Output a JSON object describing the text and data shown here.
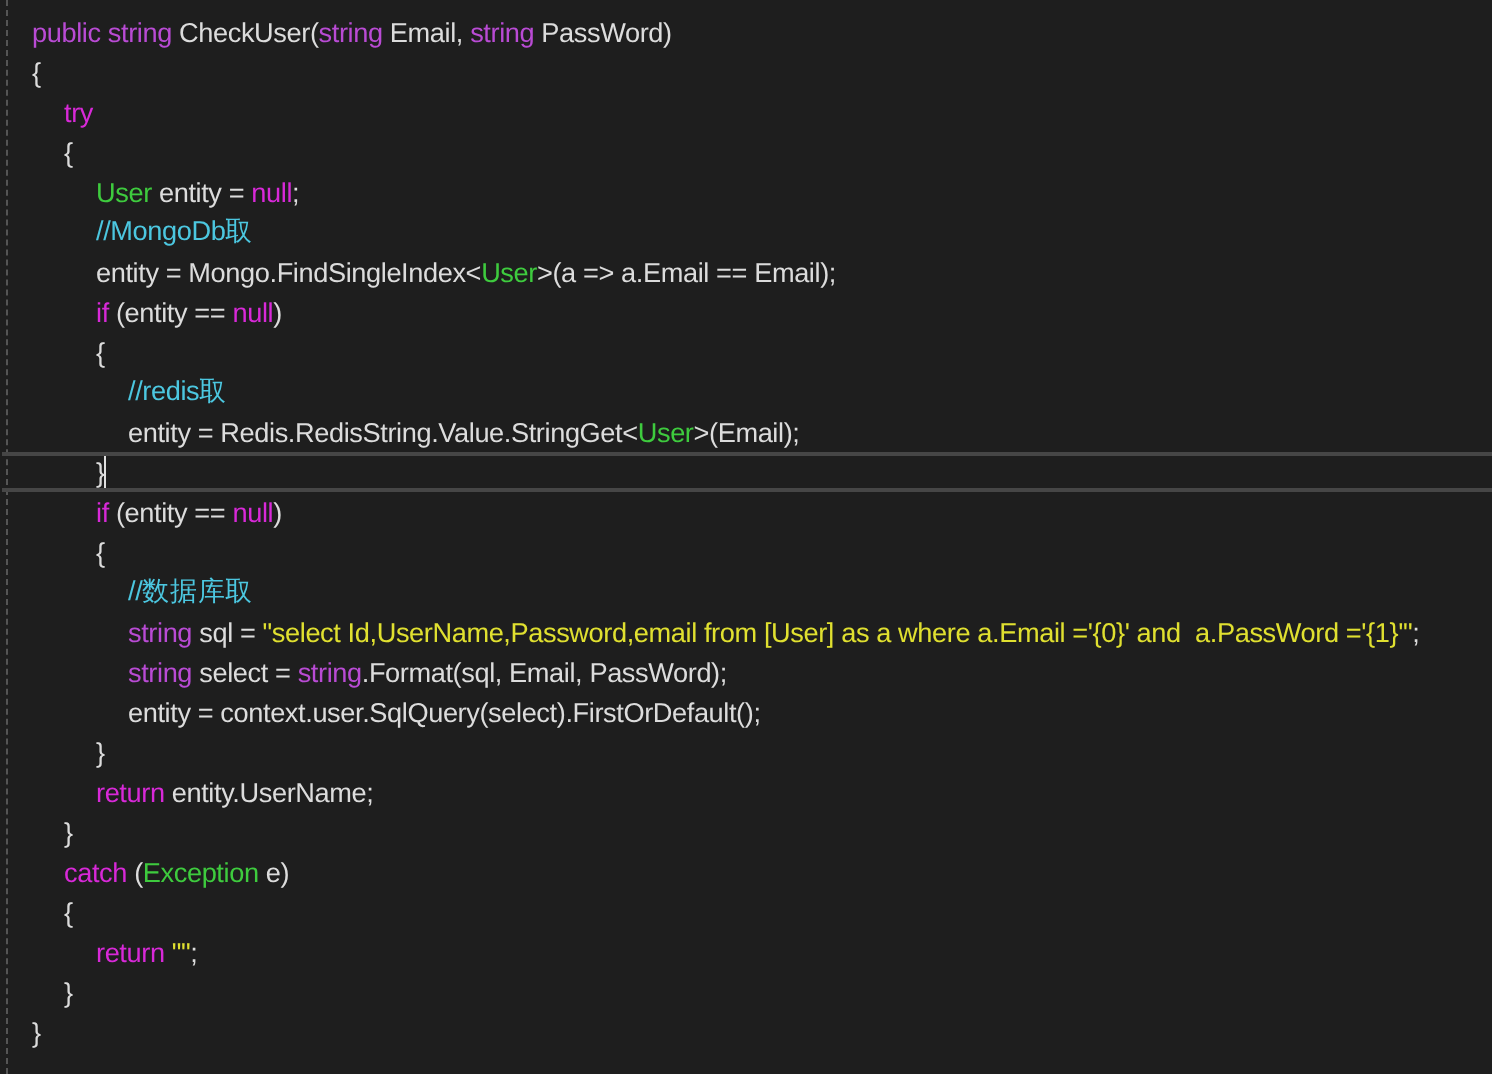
{
  "editor": {
    "lines": [
      {
        "current": false,
        "tokens": [
          {
            "kind": "keyword",
            "text": "public string"
          },
          {
            "kind": "plain",
            "text": " CheckUser("
          },
          {
            "kind": "keyword",
            "text": "string"
          },
          {
            "kind": "plain",
            "text": " Email, "
          },
          {
            "kind": "keyword",
            "text": "string"
          },
          {
            "kind": "plain",
            "text": " PassWord)"
          }
        ]
      },
      {
        "current": false,
        "tokens": [
          {
            "kind": "plain",
            "text": "{"
          }
        ],
        "children": [
          {
            "current": false,
            "tokens": [
              {
                "kind": "control",
                "text": "try"
              }
            ]
          },
          {
            "current": false,
            "tokens": [
              {
                "kind": "plain",
                "text": "{"
              }
            ],
            "children": [
              {
                "current": false,
                "tokens": [
                  {
                    "kind": "type",
                    "text": "User"
                  },
                  {
                    "kind": "plain",
                    "text": " entity = "
                  },
                  {
                    "kind": "control",
                    "text": "null"
                  },
                  {
                    "kind": "plain",
                    "text": ";"
                  }
                ]
              },
              {
                "current": false,
                "tokens": [
                  {
                    "kind": "comment",
                    "text": "//MongoDb取"
                  }
                ]
              },
              {
                "current": false,
                "tokens": [
                  {
                    "kind": "plain",
                    "text": "entity = Mongo.FindSingleIndex<"
                  },
                  {
                    "kind": "type",
                    "text": "User"
                  },
                  {
                    "kind": "plain",
                    "text": ">(a => a.Email == Email);"
                  }
                ]
              },
              {
                "current": false,
                "tokens": [
                  {
                    "kind": "control",
                    "text": "if"
                  },
                  {
                    "kind": "plain",
                    "text": " (entity == "
                  },
                  {
                    "kind": "control",
                    "text": "null"
                  },
                  {
                    "kind": "plain",
                    "text": ")"
                  }
                ]
              },
              {
                "current": false,
                "tokens": [
                  {
                    "kind": "plain",
                    "text": "{"
                  }
                ],
                "children": [
                  {
                    "current": false,
                    "tokens": [
                      {
                        "kind": "comment",
                        "text": "//redis取"
                      }
                    ]
                  },
                  {
                    "current": false,
                    "tokens": [
                      {
                        "kind": "plain",
                        "text": "entity = Redis.RedisString.Value.StringGet<"
                      },
                      {
                        "kind": "type",
                        "text": "User"
                      },
                      {
                        "kind": "plain",
                        "text": ">(Email);"
                      }
                    ]
                  }
                ]
              },
              {
                "current": true,
                "tokens": [
                  {
                    "kind": "plain",
                    "text": "}"
                  }
                ]
              },
              {
                "current": false,
                "tokens": [
                  {
                    "kind": "control",
                    "text": "if"
                  },
                  {
                    "kind": "plain",
                    "text": " (entity == "
                  },
                  {
                    "kind": "control",
                    "text": "null"
                  },
                  {
                    "kind": "plain",
                    "text": ")"
                  }
                ]
              },
              {
                "current": false,
                "tokens": [
                  {
                    "kind": "plain",
                    "text": "{"
                  }
                ],
                "children": [
                  {
                    "current": false,
                    "tokens": [
                      {
                        "kind": "comment",
                        "text": "//数据库取"
                      }
                    ]
                  },
                  {
                    "current": false,
                    "tokens": [
                      {
                        "kind": "keyword",
                        "text": "string"
                      },
                      {
                        "kind": "plain",
                        "text": " sql = "
                      },
                      {
                        "kind": "string",
                        "text": "\"select Id,UserName,Password,email from [User] as a where a.Email ='{0}' and  a.PassWord ='{1}'\""
                      },
                      {
                        "kind": "plain",
                        "text": ";"
                      }
                    ]
                  },
                  {
                    "current": false,
                    "tokens": [
                      {
                        "kind": "keyword",
                        "text": "string"
                      },
                      {
                        "kind": "plain",
                        "text": " select = "
                      },
                      {
                        "kind": "keyword",
                        "text": "string"
                      },
                      {
                        "kind": "plain",
                        "text": ".Format(sql, Email, PassWord);"
                      }
                    ]
                  },
                  {
                    "current": false,
                    "tokens": [
                      {
                        "kind": "plain",
                        "text": "entity = context.user.SqlQuery(select).FirstOrDefault();"
                      }
                    ]
                  }
                ]
              },
              {
                "current": false,
                "tokens": [
                  {
                    "kind": "plain",
                    "text": "}"
                  }
                ]
              },
              {
                "current": false,
                "tokens": [
                  {
                    "kind": "control",
                    "text": "return"
                  },
                  {
                    "kind": "plain",
                    "text": " entity.UserName;"
                  }
                ]
              }
            ]
          },
          {
            "current": false,
            "tokens": [
              {
                "kind": "plain",
                "text": "}"
              }
            ]
          },
          {
            "current": false,
            "tokens": [
              {
                "kind": "control",
                "text": "catch"
              },
              {
                "kind": "plain",
                "text": " ("
              },
              {
                "kind": "type",
                "text": "Exception"
              },
              {
                "kind": "plain",
                "text": " e)"
              }
            ]
          },
          {
            "current": false,
            "tokens": [
              {
                "kind": "plain",
                "text": "{"
              }
            ],
            "children": [
              {
                "current": false,
                "tokens": [
                  {
                    "kind": "control",
                    "text": "return"
                  },
                  {
                    "kind": "string",
                    "text": " \"\""
                  },
                  {
                    "kind": "plain",
                    "text": ";"
                  }
                ]
              }
            ]
          },
          {
            "current": false,
            "tokens": [
              {
                "kind": "plain",
                "text": "}"
              }
            ]
          }
        ]
      },
      {
        "current": false,
        "tokens": [
          {
            "kind": "plain",
            "text": "}"
          }
        ]
      }
    ]
  }
}
